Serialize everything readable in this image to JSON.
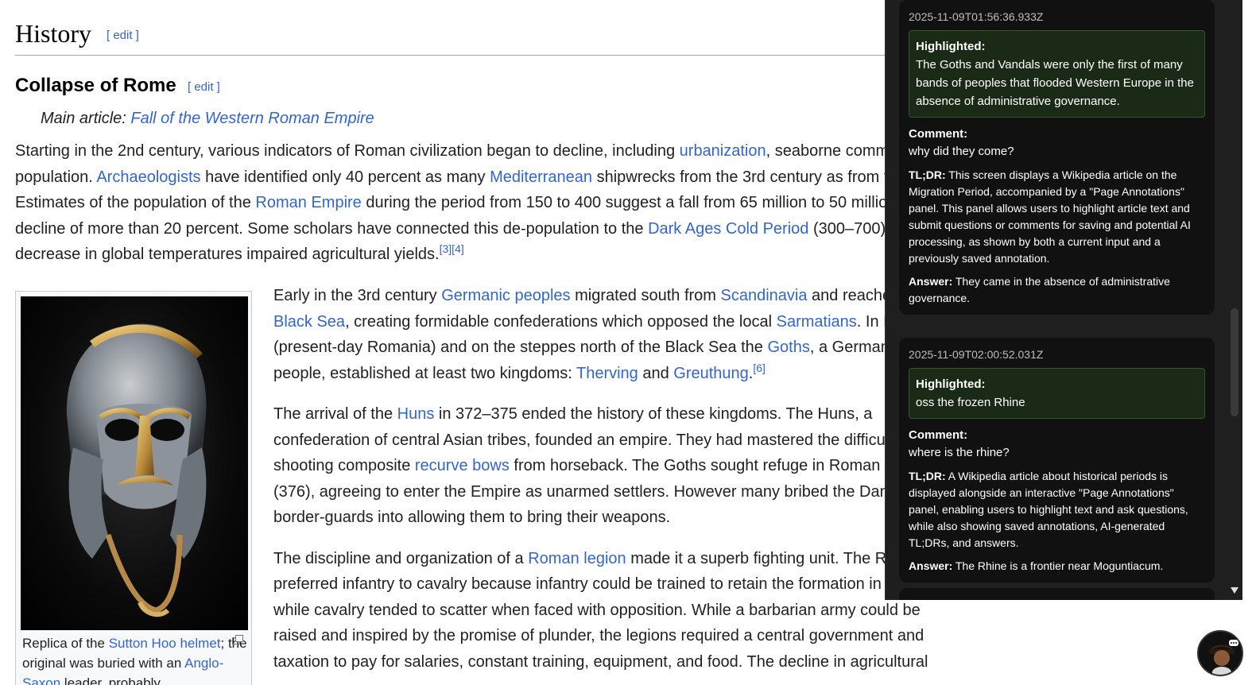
{
  "article": {
    "h2_title": "History",
    "h2_edit": "[ edit ]",
    "h3_title": "Collapse of Rome",
    "h3_edit": "[ edit ]",
    "hatnote_prefix": "Main article: ",
    "hatnote_link": "Fall of the Western Roman Empire",
    "para1": {
      "l1_a": "Starting in the 2nd century, various indicators of Roman civilization began to decline, including ",
      "l1_link": "urbanization",
      "l1_b": ", seaborne comm",
      "l2_a": "population. ",
      "l2_link1": "Archaeologists",
      "l2_b": " have identified only 40 percent as many ",
      "l2_link2": "Mediterranean",
      "l2_c": " shipwrecks from the 3rd century as from t",
      "l3_a": "Estimates of the population of the ",
      "l3_link": "Roman Empire",
      "l3_b": " during the period from 150 to 400 suggest a fall from 65 million to 50 millio",
      "l4_a": "decline of more than 20 percent. Some scholars have connected this de-population to the ",
      "l4_link": "Dark Ages Cold Period",
      "l4_b": " (300–700),",
      "l5_a": "decrease in global temperatures impaired agricultural yields.",
      "l5_ref": "[3][4]"
    },
    "caption": {
      "a": "Replica of the ",
      "link1": "Sutton Hoo helmet",
      "b": "; the original was buried with an ",
      "link2": "Anglo-Saxon",
      "c": " leader, probably"
    },
    "p2": {
      "l1_a": "Early in the 3rd century ",
      "l1_link1": "Germanic peoples",
      "l1_b": " migrated south from ",
      "l1_link2": "Scandinavia",
      "l1_c": " and reache",
      "l2_link1": "Black Sea",
      "l2_a": ", creating formidable confederations which opposed the local ",
      "l2_link2": "Sarmatians",
      "l2_b": ". In ",
      "l2_link3": "D",
      "l3_a": "(present-day Romania) and on the steppes north of the Black Sea the ",
      "l3_link": "Goths",
      "l3_b": ", a German",
      "l4_a": "people, established at least two kingdoms: ",
      "l4_link1": "Therving",
      "l4_b": " and ",
      "l4_link2": "Greuthung",
      "l4_c": ".",
      "l4_ref": "[6]"
    },
    "p3": {
      "l1_a": "The arrival of the ",
      "l1_link": "Huns",
      "l1_b": " in 372–375 ended the history of these kingdoms. The Huns, a",
      "l2": "confederation of central Asian tribes, founded an empire. They had mastered the difficul",
      "l3_a": "shooting composite ",
      "l3_link": "recurve bows",
      "l3_b": " from horseback. The Goths sought refuge in Roman t",
      "l4": "(376), agreeing to enter the Empire as unarmed settlers. However many bribed the Dan",
      "l5": "border-guards into allowing them to bring their weapons."
    },
    "p4": {
      "l1_a": "The discipline and organization of a ",
      "l1_link": "Roman legion",
      "l1_b": " made it a superb fighting unit. The R",
      "l2": "preferred infantry to cavalry because infantry could be trained to retain the formation in",
      "l3": "while cavalry tended to scatter when faced with opposition. While a barbarian army could be",
      "l4": "raised and inspired by the promise of plunder, the legions required a central government and",
      "l5": "taxation to pay for salaries, constant training, equipment, and food. The decline in agricultural"
    }
  },
  "panel": {
    "highlighted_label": "Highlighted:",
    "comment_label": "Comment:",
    "tldr_label": "TL;DR:",
    "answer_label": "Answer:",
    "annotations": [
      {
        "timestamp": "2025-11-09T01:56:36.933Z",
        "highlighted": "The Goths and Vandals were only the first of many bands of peoples that flooded Western Europe in the absence of administrative governance.",
        "comment": "why did they come?",
        "tldr": "This screen displays a Wikipedia article on the Migration Period, accompanied by a \"Page Annotations\" panel. This panel allows users to highlight article text and submit questions or comments for saving and potential AI processing, as shown by both a current input and a previously saved annotation.",
        "answer": "They came in the absence of administrative governance."
      },
      {
        "timestamp": "2025-11-09T02:00:52.031Z",
        "highlighted": "oss the frozen Rhine",
        "comment": "where is the rhine?",
        "tldr": "A Wikipedia article about historical periods is displayed alongside an interactive \"Page Annotations\" panel, enabling users to highlight text and ask questions, while also showing saved annotations, AI-generated TL;DRs, and answers.",
        "answer": "The Rhine is a frontier near Moguntiacum."
      }
    ]
  },
  "colors": {
    "link": "#3366cc",
    "panel_bg": "#1f1f1f",
    "card_bg": "#111111",
    "highlight_bg": "#1b2a16",
    "highlight_border": "#2f5a27"
  }
}
